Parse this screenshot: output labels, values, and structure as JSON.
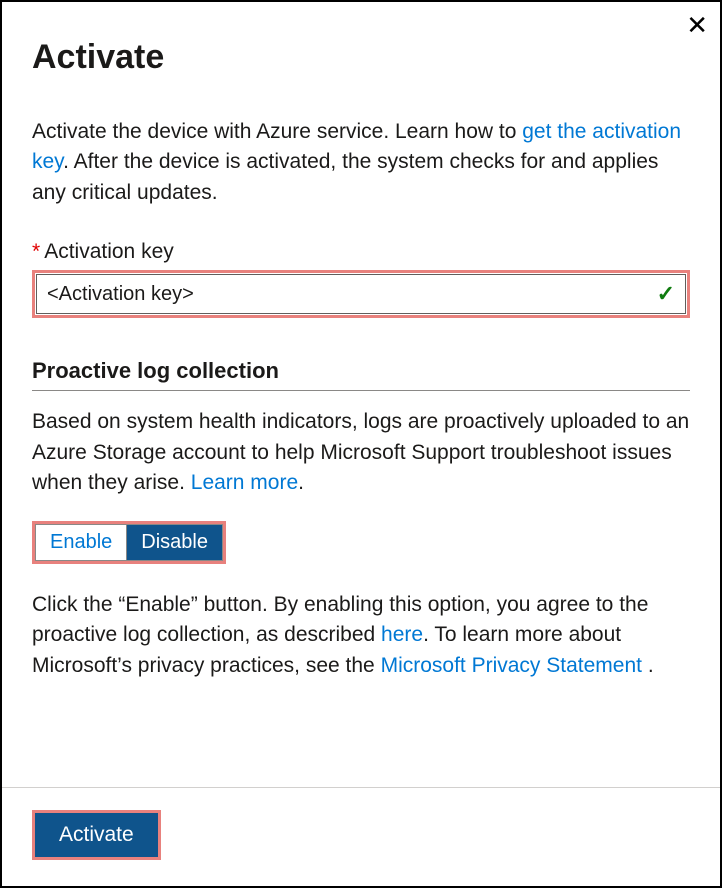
{
  "header": {
    "title": "Activate",
    "close_icon": "✕"
  },
  "intro": {
    "part1": "Activate the device with Azure service. Learn how to ",
    "link1": "get the activation key",
    "part2": ". After the device is activated, the system checks for and applies any critical updates."
  },
  "field": {
    "required_marker": "*",
    "label": "Activation key",
    "value": "<Activation key>",
    "validated_icon": "✓"
  },
  "section": {
    "title": "Proactive log collection",
    "description_part1": "Based on system health indicators, logs are proactively uploaded to an Azure Storage account to help Microsoft Support troubleshoot issues when they arise. ",
    "description_link": "Learn more",
    "description_part2": ".",
    "toggle": {
      "enable": "Enable",
      "disable": "Disable",
      "selected": "disable"
    },
    "agreement_part1": "Click the “Enable” button. By enabling this option, you agree to the proactive log collection, as described ",
    "agreement_link1": "here",
    "agreement_part2": ". To learn more about Microsoft’s privacy practices, see the ",
    "agreement_link2": "Microsoft Privacy Statement",
    "agreement_part3": " ."
  },
  "footer": {
    "activate_label": "Activate"
  }
}
